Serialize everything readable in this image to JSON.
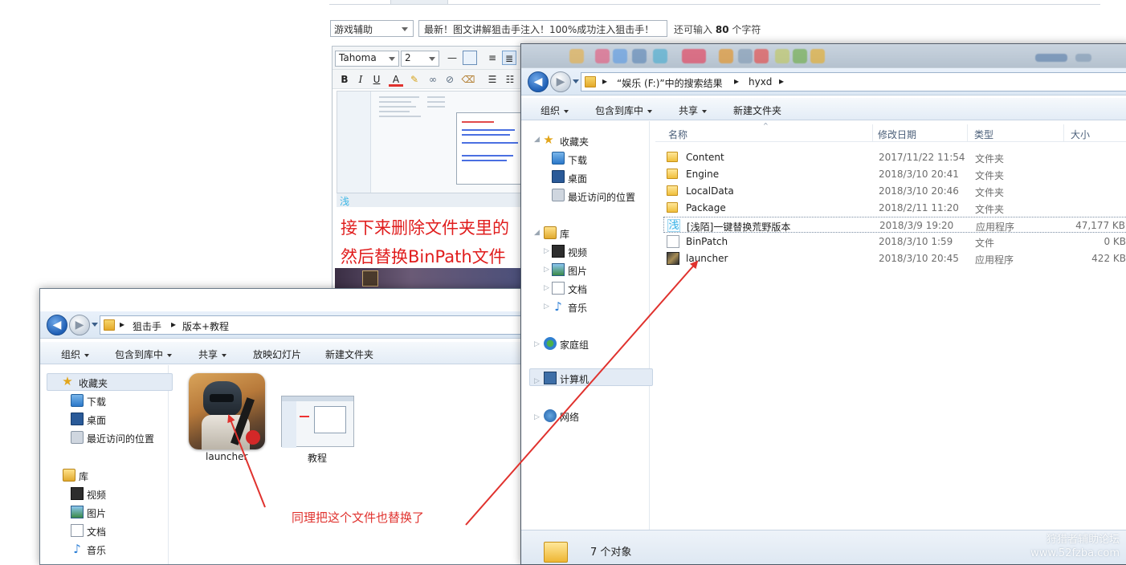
{
  "editor": {
    "category_select": "游戏辅助",
    "title_input_value": "最新！图文讲解狙击手注入！100%成功注入狙击手！",
    "char_count_prefix": "还可输入",
    "char_count_value": "80",
    "char_count_suffix": "个字符",
    "font_select": "Tahoma",
    "size_select": "2",
    "toolbar": {
      "bold": "B",
      "italic": "I",
      "underline": "U",
      "font_color": "A"
    },
    "body_line1": "接下来删除文件夹里的",
    "body_line2": "然后替换BinPath文件",
    "thumb_status_char": "浅"
  },
  "back_window": {
    "breadcrumb": [
      "狙击手",
      "版本+教程"
    ],
    "commands": [
      "组织",
      "包含到库中",
      "共享",
      "放映幻灯片",
      "新建文件夹"
    ],
    "nav": {
      "favorites": "收藏夹",
      "fav_items": [
        "下载",
        "桌面",
        "最近访问的位置"
      ],
      "libraries": "库",
      "lib_items": [
        "视频",
        "图片",
        "文档",
        "音乐"
      ]
    },
    "files": [
      {
        "name": "launcher",
        "icon": "game-launcher-icon"
      },
      {
        "name": "教程",
        "icon": "image-thumbnail-icon"
      }
    ]
  },
  "front_window": {
    "breadcrumb": [
      "“娱乐 (F:)”中的搜索结果",
      "hyxd"
    ],
    "commands": [
      "组织",
      "包含到库中",
      "共享",
      "新建文件夹"
    ],
    "nav": {
      "favorites": "收藏夹",
      "fav_items": [
        "下载",
        "桌面",
        "最近访问的位置"
      ],
      "libraries": "库",
      "lib_items": [
        "视频",
        "图片",
        "文档",
        "音乐"
      ],
      "homegroup": "家庭组",
      "computer": "计算机",
      "network": "网络"
    },
    "columns": {
      "name": "名称",
      "date": "修改日期",
      "type": "类型",
      "size": "大小"
    },
    "rows": [
      {
        "name": "Content",
        "date": "2017/11/22 11:54",
        "type": "文件夹",
        "size": "",
        "icon": "folder-icon"
      },
      {
        "name": "Engine",
        "date": "2018/3/10 20:41",
        "type": "文件夹",
        "size": "",
        "icon": "folder-icon"
      },
      {
        "name": "LocalData",
        "date": "2018/3/10 20:46",
        "type": "文件夹",
        "size": "",
        "icon": "folder-icon"
      },
      {
        "name": "Package",
        "date": "2018/2/11 11:20",
        "type": "文件夹",
        "size": "",
        "icon": "folder-icon"
      },
      {
        "name": "[浅陌]一键替换荒野版本",
        "date": "2018/3/9 19:20",
        "type": "应用程序",
        "size": "47,177 KB",
        "icon": "app-icon"
      },
      {
        "name": "BinPatch",
        "date": "2018/3/10 1:59",
        "type": "文件",
        "size": "0 KB",
        "icon": "file-icon"
      },
      {
        "name": "launcher",
        "date": "2018/3/10 20:45",
        "type": "应用程序",
        "size": "422 KB",
        "icon": "game-launcher-icon"
      }
    ],
    "status_count": "7 个对象"
  },
  "annotation": {
    "text": "同理把这个文件也替换了",
    "color": "#e0322e"
  },
  "watermark": {
    "line1": "狩猎者辅助论坛",
    "line2": "www.52fzba.com"
  }
}
